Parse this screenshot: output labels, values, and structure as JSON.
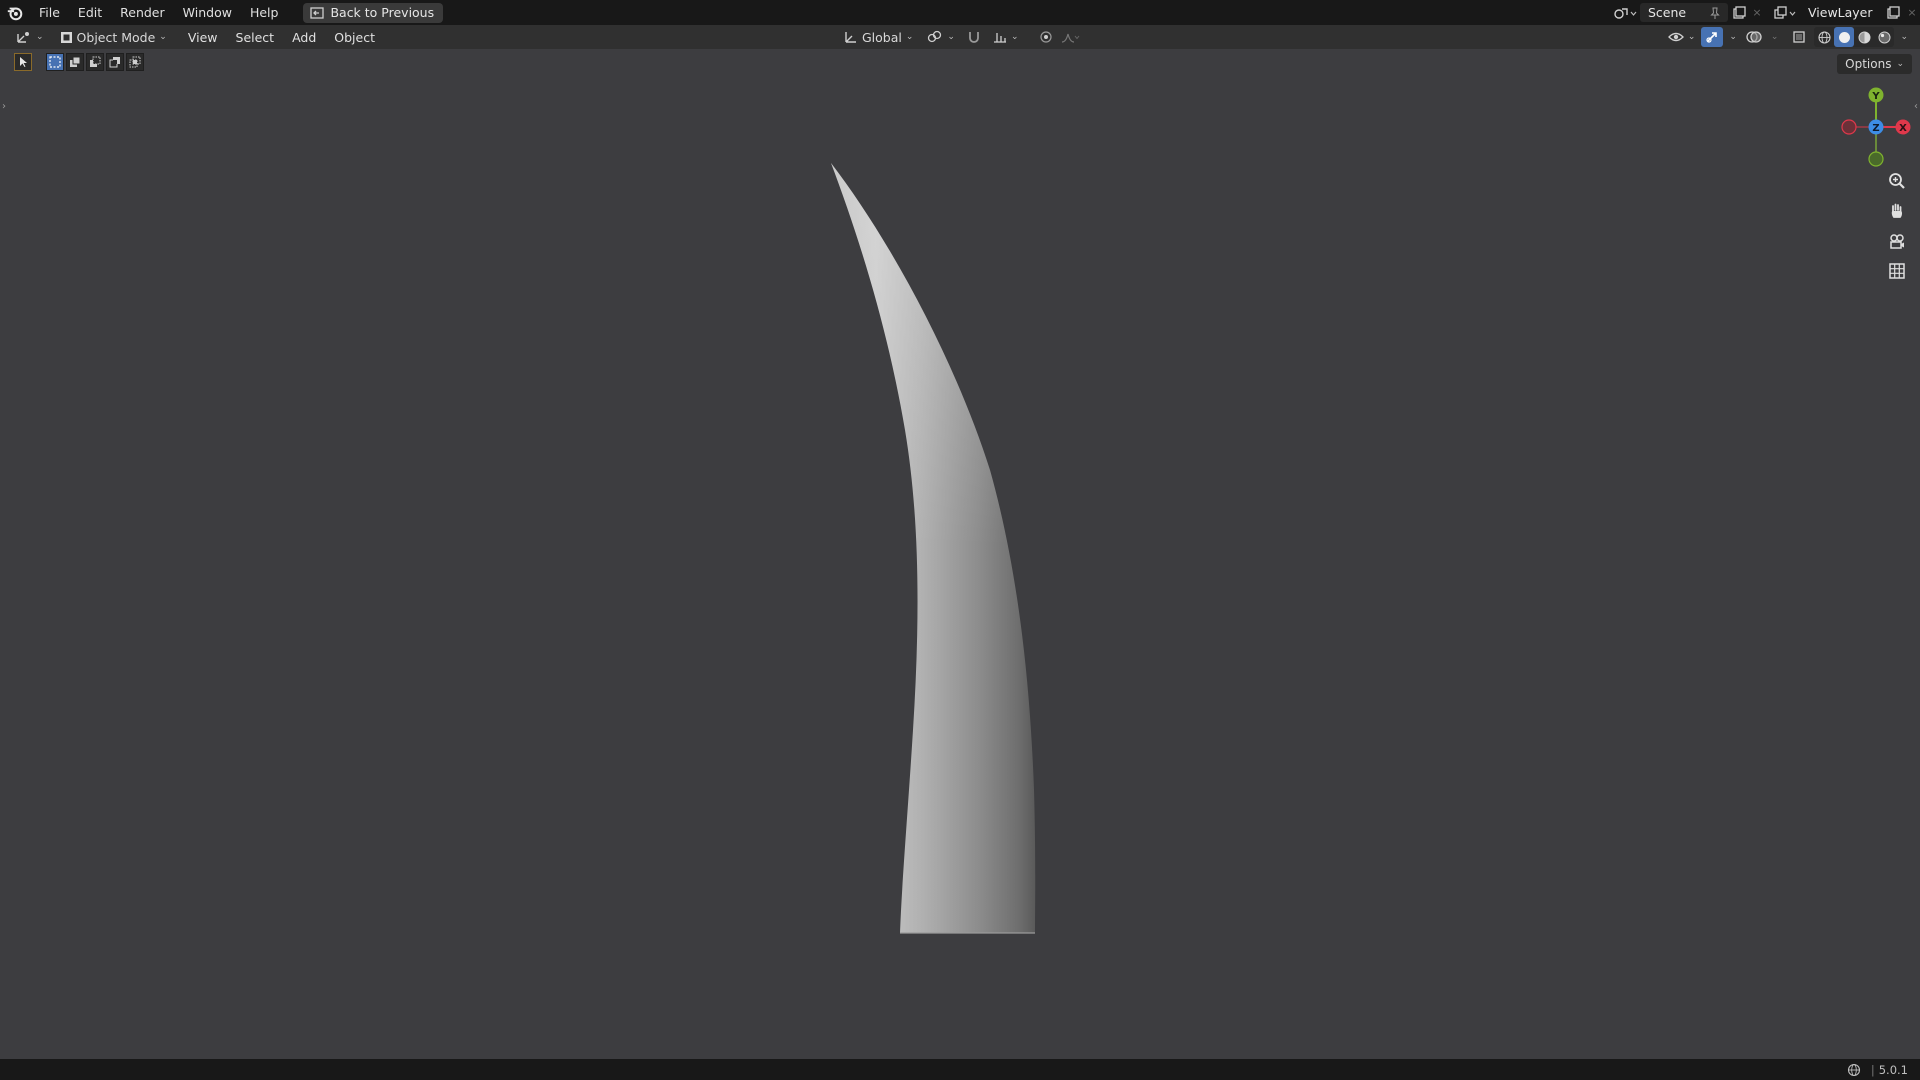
{
  "app": {
    "name": "Blender"
  },
  "topbar": {
    "menus": [
      "File",
      "Edit",
      "Render",
      "Window",
      "Help"
    ],
    "back_button": "Back to Previous",
    "scene": "Scene",
    "view_layer": "ViewLayer"
  },
  "header": {
    "mode": "Object Mode",
    "menus": [
      "View",
      "Select",
      "Add",
      "Object"
    ],
    "transform_orientation": "Global"
  },
  "viewport": {
    "options_label": "Options",
    "object": "horn-mesh",
    "gizmo": {
      "x": "X",
      "y": "Y",
      "z": "Z"
    }
  },
  "status": {
    "version": "5.0.1"
  },
  "colors": {
    "axis_x": "#e0384b",
    "axis_y": "#7fb32e",
    "axis_z": "#3d8de6",
    "accent": "#4772b3"
  }
}
